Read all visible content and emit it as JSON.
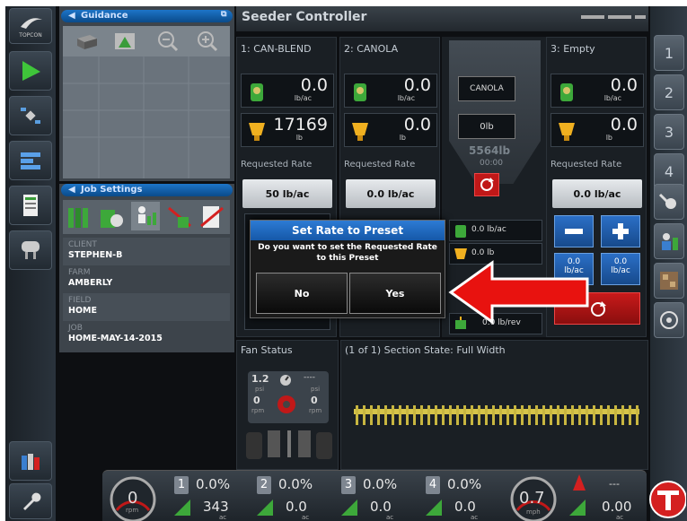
{
  "nav": {
    "topcon_label": "TOPCON"
  },
  "guidance": {
    "title": "Guidance"
  },
  "job": {
    "title": "Job Settings",
    "fields": [
      {
        "label": "CLIENT",
        "value": "STEPHEN-B"
      },
      {
        "label": "FARM",
        "value": "AMBERLY"
      },
      {
        "label": "FIELD",
        "value": "HOME"
      },
      {
        "label": "JOB",
        "value": "HOME-MAY-14-2015"
      }
    ]
  },
  "header": {
    "title": "Seeder Controller"
  },
  "bins": [
    {
      "name": "1: CAN-BLEND",
      "rate": "0.0",
      "rate_unit": "lb/ac",
      "weight": "17169",
      "weight_unit": "lb",
      "requested_label": "Requested Rate",
      "requested": "50 lb/ac"
    },
    {
      "name": "2: CANOLA",
      "rate": "0.0",
      "rate_unit": "lb/ac",
      "weight": "0.0",
      "weight_unit": "lb",
      "requested_label": "Requested Rate",
      "requested": "0.0 lb/ac"
    },
    {
      "name": "3: Empty",
      "rate": "0.0",
      "rate_unit": "lb/ac",
      "weight": "0.0",
      "weight_unit": "lb",
      "requested_label": "Requested Rate",
      "requested": "0.0 lb/ac"
    }
  ],
  "calib": {
    "product": "CANOLA",
    "weight": "0lb",
    "total": "5564lb",
    "time": "00:00",
    "rows": [
      "0.0 lb/ac",
      "0.0 lb",
      "0.0 lb/rev"
    ]
  },
  "bin3_presets": {
    "left": "0.0",
    "left_unit": "lb/ac",
    "right": "0.0",
    "right_unit": "lb/ac"
  },
  "dialog": {
    "title": "Set Rate to Preset",
    "message": "Do you want to set the Requested Rate to this Preset",
    "no": "No",
    "yes": "Yes"
  },
  "fan": {
    "title": "Fan Status",
    "pressure1": "1.2",
    "pressure1_unit": "psi",
    "pressure2": "----",
    "pressure2_unit": "psi",
    "rpm1": "0",
    "rpm1_unit": "rpm",
    "rpm2": "0",
    "rpm2_unit": "rpm"
  },
  "sections": {
    "title": "(1 of 1) Section State: Full Width"
  },
  "right_buttons": [
    "1",
    "2",
    "3",
    "4"
  ],
  "bottom": {
    "rpm_value": "0",
    "rpm_unit": "rpm",
    "speed_value": "0.7",
    "speed_unit": "mph",
    "channels": [
      {
        "num": "1",
        "pct": "0.0%",
        "val": "343",
        "unit": "ac"
      },
      {
        "num": "2",
        "pct": "0.0%",
        "val": "0.0",
        "unit": "ac"
      },
      {
        "num": "3",
        "pct": "0.0%",
        "val": "0.0",
        "unit": "ac"
      },
      {
        "num": "4",
        "pct": "0.0%",
        "val": "0.0",
        "unit": "ac"
      }
    ],
    "area_top": "---",
    "area_val": "0.00",
    "area_unit": "ac"
  },
  "colors": {
    "accent_blue": "#1d6fc4",
    "alert_red": "#e8120f",
    "grass_green": "#3da83a"
  }
}
